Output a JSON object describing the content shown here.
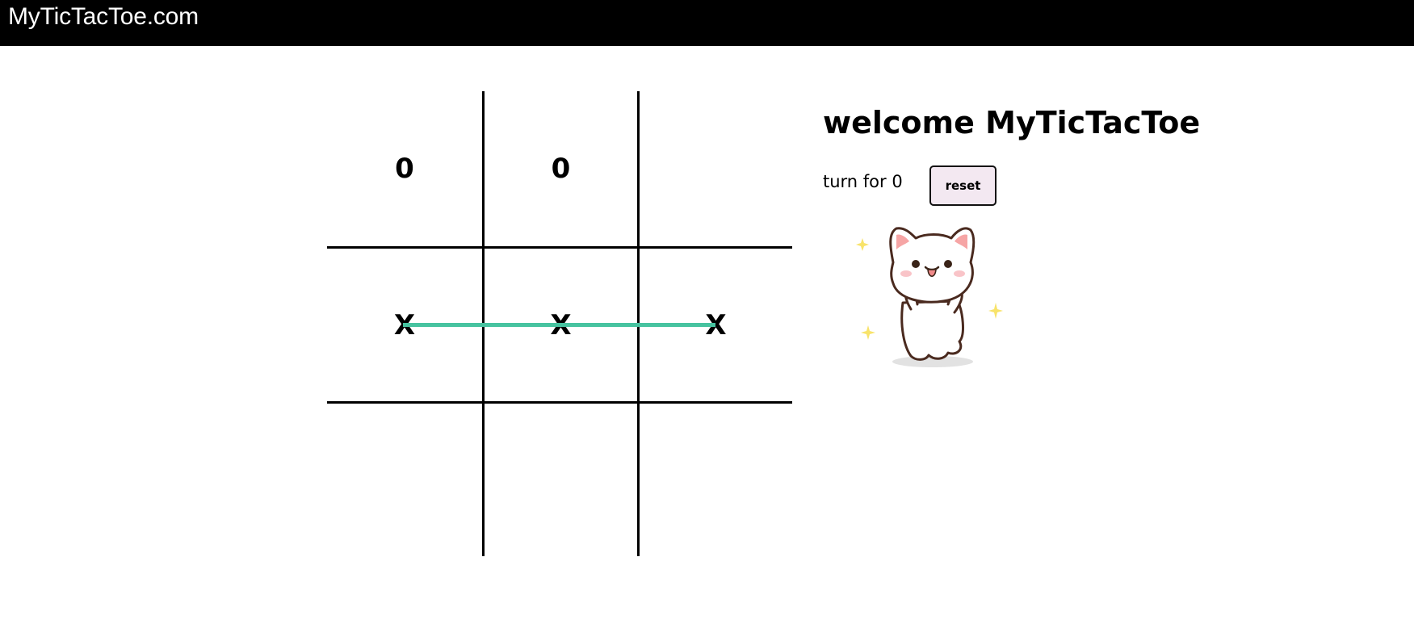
{
  "header": {
    "brand": "MyTicTacToe.com"
  },
  "board": {
    "cells": [
      "0",
      "0",
      "",
      "X",
      "X",
      "X",
      "",
      "",
      ""
    ],
    "winning_row": [
      3,
      4,
      5
    ],
    "win_line_color": "#47c3a0"
  },
  "side": {
    "title": "welcome MyTicTacToe",
    "turn_text": "turn for 0",
    "reset_label": "reset"
  },
  "colors": {
    "header_bg": "#000000",
    "reset_bg": "#f3e8f1"
  },
  "cat_image": {
    "icon": "happy-cat-sticker-icon"
  }
}
